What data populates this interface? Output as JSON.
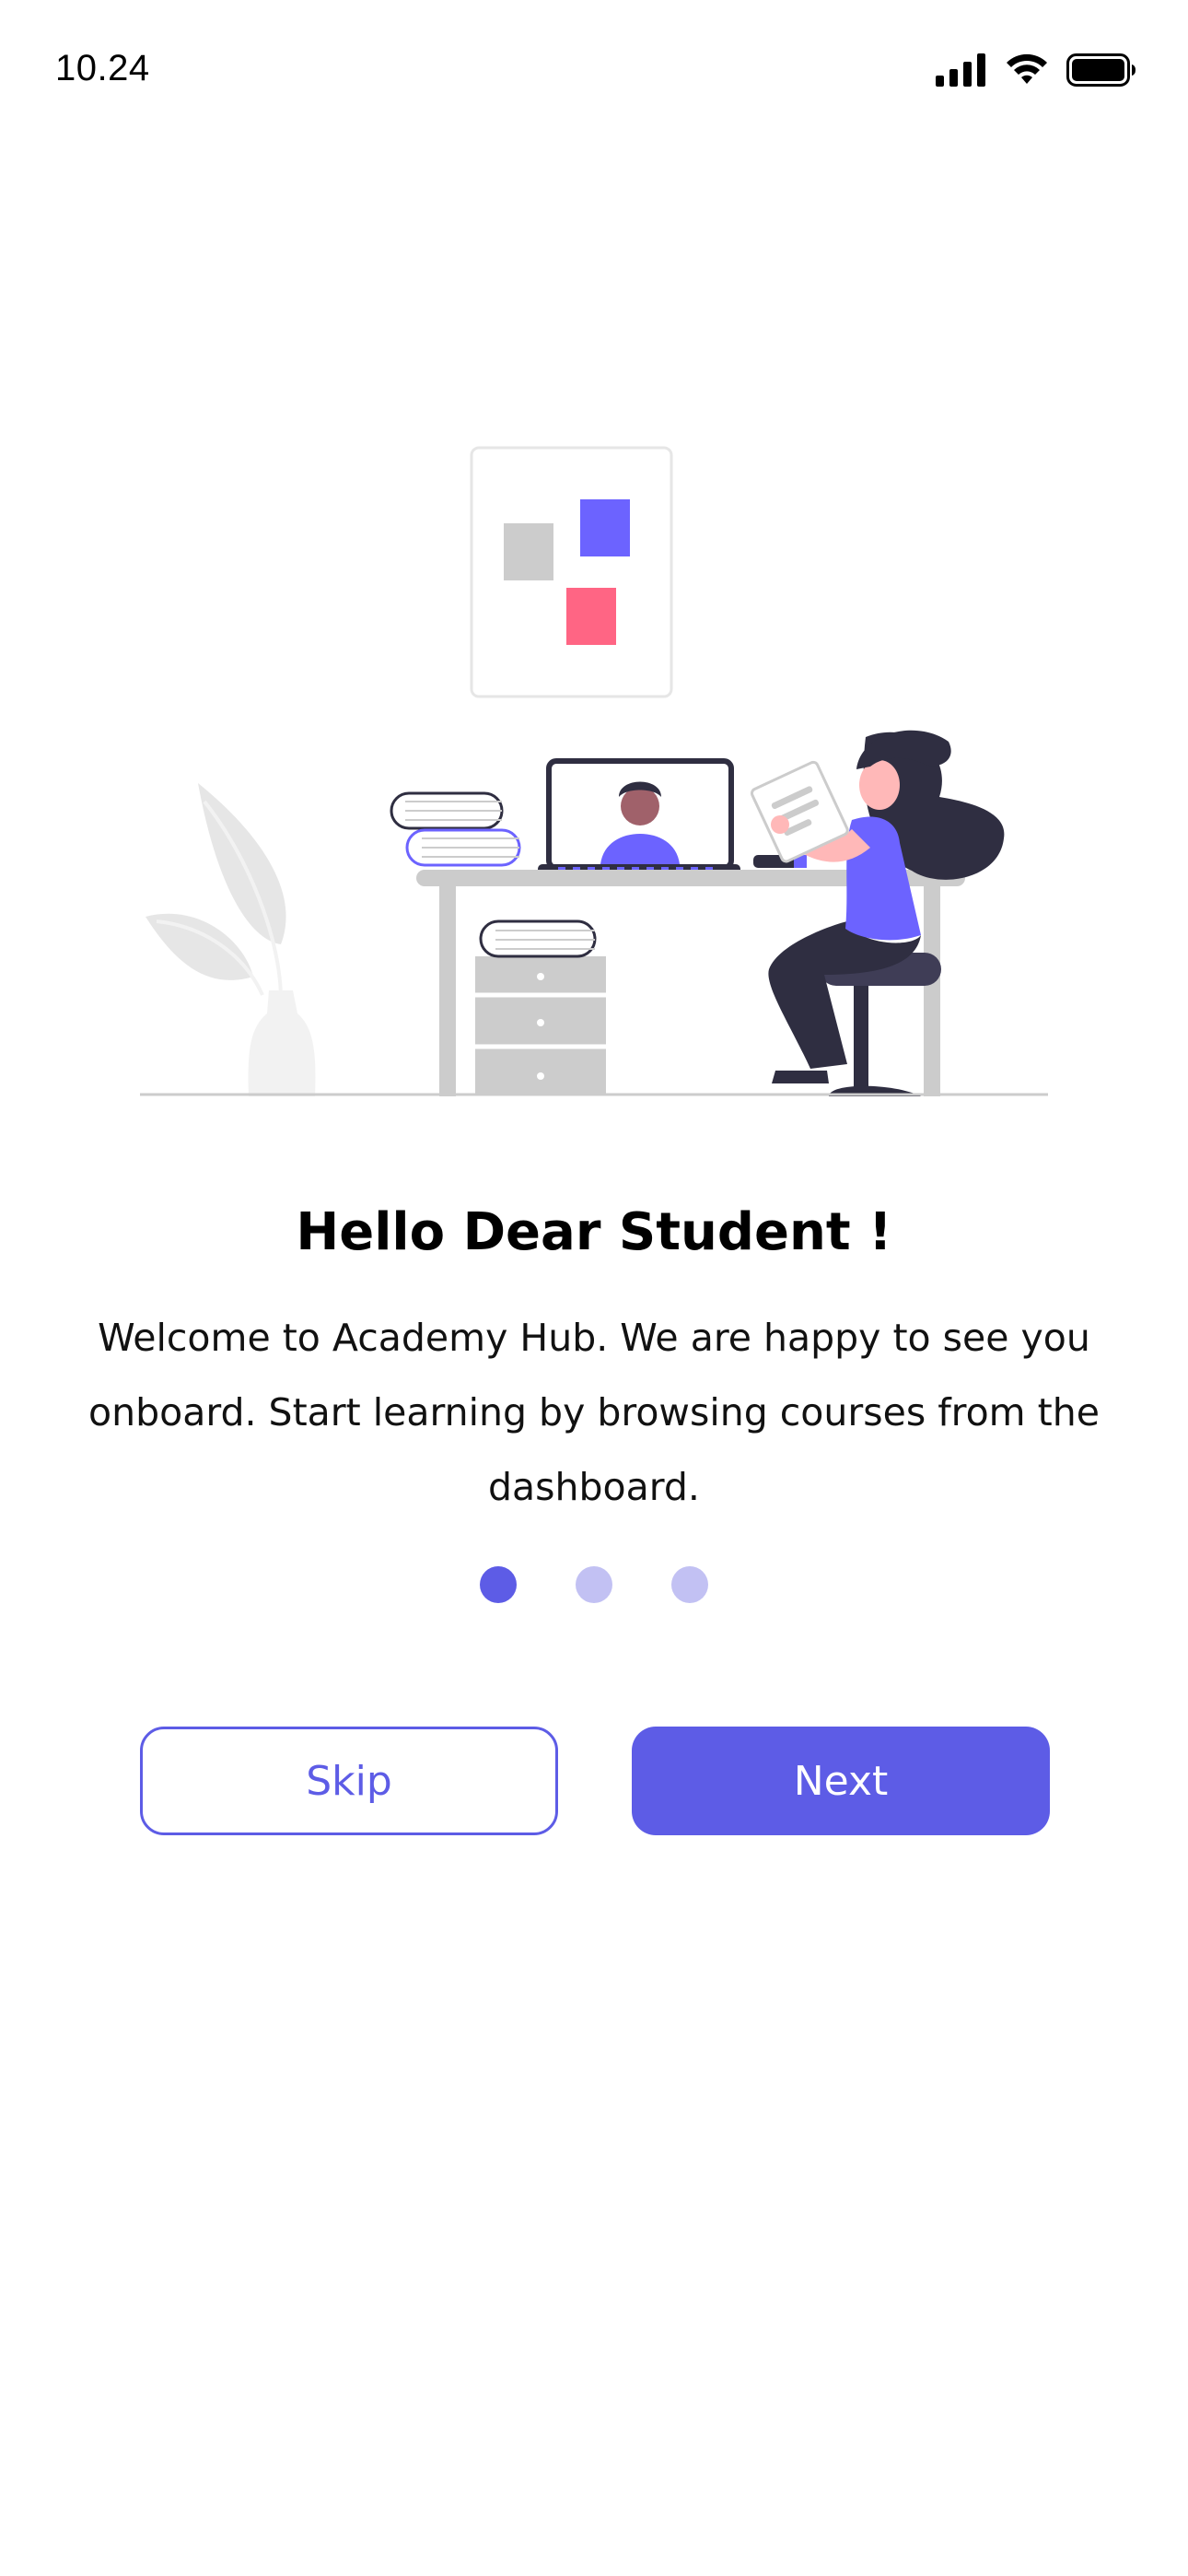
{
  "status_bar": {
    "time": "10.24",
    "icons": [
      "cellular-signal-icon",
      "wifi-icon",
      "battery-icon"
    ]
  },
  "illustration": {
    "name": "student-at-desk-illustration"
  },
  "onboarding": {
    "title": "Hello Dear Student !",
    "description": "Welcome to Academy Hub. We are happy to see you onboard. Start learning by browsing courses from the dashboard.",
    "page_indicator": {
      "total": 3,
      "active_index": 0
    }
  },
  "actions": {
    "skip_label": "Skip",
    "next_label": "Next"
  },
  "colors": {
    "primary": "#5D5CE6",
    "dot_inactive": "#C2C1F3",
    "accent_purple": "#6C63FF",
    "accent_pink": "#FF6584",
    "dark": "#2F2E41",
    "gray": "#CCCCCC"
  }
}
